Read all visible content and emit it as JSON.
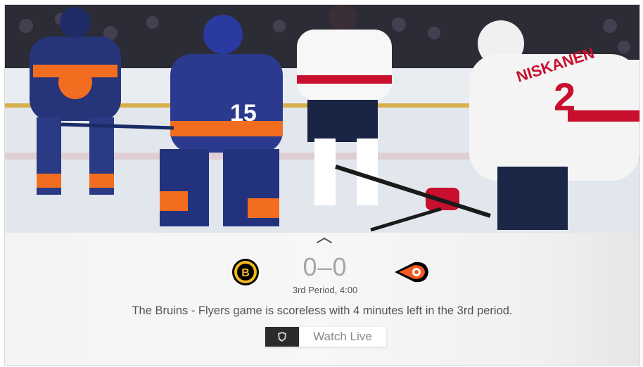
{
  "hero": {
    "image": "hockey-game-action-photo",
    "jersey_numbers": [
      "15",
      "2"
    ],
    "player_names": [
      "NISKANEN"
    ]
  },
  "scoreboard": {
    "home_team": {
      "name": "Bruins",
      "logo_icon": "bruins-logo-icon"
    },
    "away_team": {
      "name": "Flyers",
      "logo_icon": "flyers-logo-icon"
    },
    "score": "0–0",
    "period": "3rd Period, 4:00"
  },
  "summary": "The Bruins - Flyers game is scoreless with 4 minutes left in the 3rd period.",
  "watch_button": {
    "badge_icon": "nhl-shield-icon",
    "label": "Watch Live"
  },
  "colors": {
    "panel_bg": "#f4f4f4",
    "score_text": "#a6a6a6",
    "badge_bg": "#2b2b2b",
    "flyers_orange": "#f15a24",
    "bruins_gold": "#f2b51c"
  }
}
